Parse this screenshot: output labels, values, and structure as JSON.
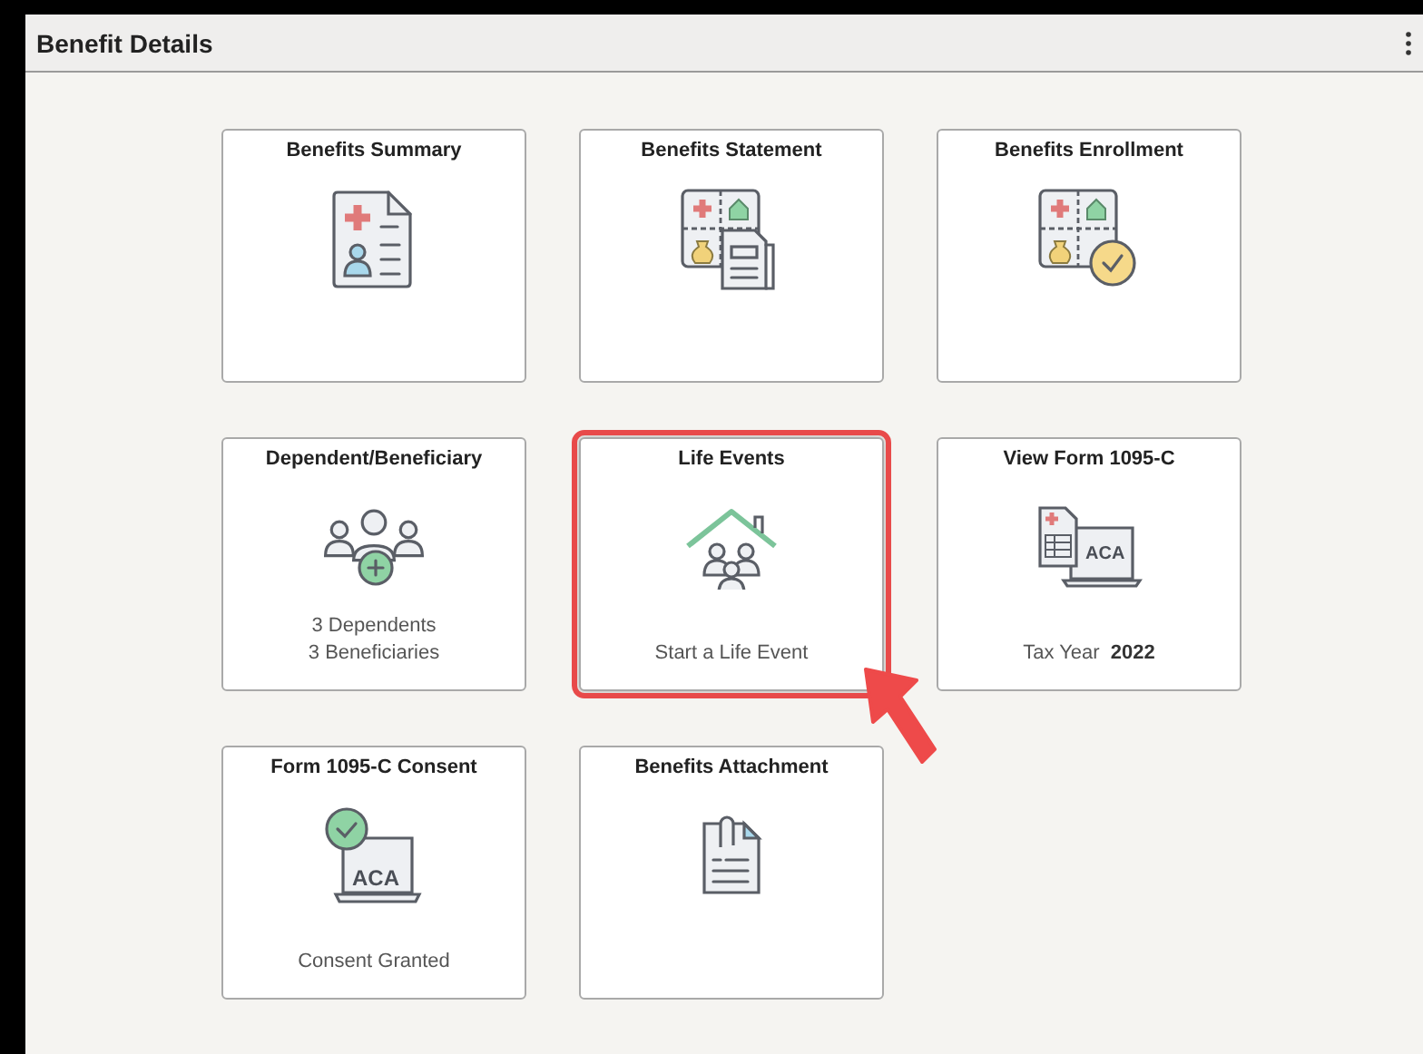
{
  "panel": {
    "title": "Benefit Details"
  },
  "tiles": [
    {
      "title": "Benefits Summary",
      "highlighted": false
    },
    {
      "title": "Benefits Statement",
      "highlighted": false
    },
    {
      "title": "Benefits Enrollment",
      "highlighted": false
    },
    {
      "title": "Dependent/Beneficiary",
      "details": [
        "3 Dependents",
        "3 Beneficiaries"
      ],
      "highlighted": false
    },
    {
      "title": "Life Events",
      "details": [
        "Start a Life Event"
      ],
      "highlighted": true
    },
    {
      "title": "View Form 1095-C",
      "icon_text": "ACA",
      "details": [
        "Tax Year  **2022**"
      ],
      "highlighted": false
    },
    {
      "title": "Form 1095-C Consent",
      "icon_text": "ACA",
      "details": [
        "Consent Granted"
      ],
      "highlighted": false
    },
    {
      "title": "Benefits Attachment",
      "highlighted": false
    }
  ]
}
